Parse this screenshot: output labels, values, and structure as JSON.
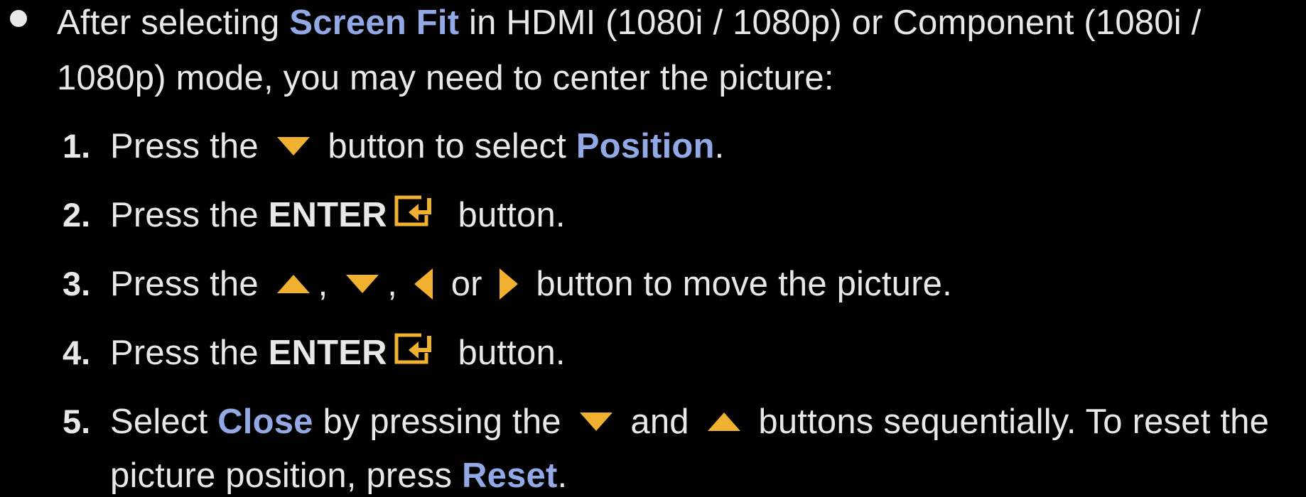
{
  "bullet": {
    "text_before": "After selecting ",
    "highlight": "Screen Fit",
    "text_after_line1": " in HDMI (1080i / 1080p) or Component (1080i /",
    "text_line2": "1080p) mode, you may need to center the picture:"
  },
  "steps": [
    {
      "number": "1.",
      "part1": "Press the ",
      "icon": "down-arrow",
      "part2": " button to select ",
      "highlight": "Position",
      "part3": "."
    },
    {
      "number": "2.",
      "part1": "Press the ",
      "bold": "ENTER",
      "icon": "enter-icon",
      "part2": " button."
    },
    {
      "number": "3.",
      "part1": "Press the ",
      "icons": [
        "up-arrow",
        "down-arrow",
        "left-arrow",
        "right-arrow"
      ],
      "sep1": ", ",
      "sep2": ", ",
      "sep3": " or ",
      "part2": " button to move the picture."
    },
    {
      "number": "4.",
      "part1": "Press the ",
      "bold": "ENTER",
      "icon": "enter-icon",
      "part2": " button."
    },
    {
      "number": "5.",
      "part1": "Select ",
      "highlight": "Close",
      "part2": " by pressing the ",
      "icon_a": "down-arrow",
      "part3": " and ",
      "icon_b": "up-arrow",
      "part4": " buttons sequentially. To reset the",
      "line2_part1": "picture position, press ",
      "line2_highlight": "Reset",
      "line2_part2": "."
    }
  ],
  "colors": {
    "background": "#000000",
    "text": "#e8e8e8",
    "highlight": "#92a9e6",
    "icon": "#f0b030"
  }
}
